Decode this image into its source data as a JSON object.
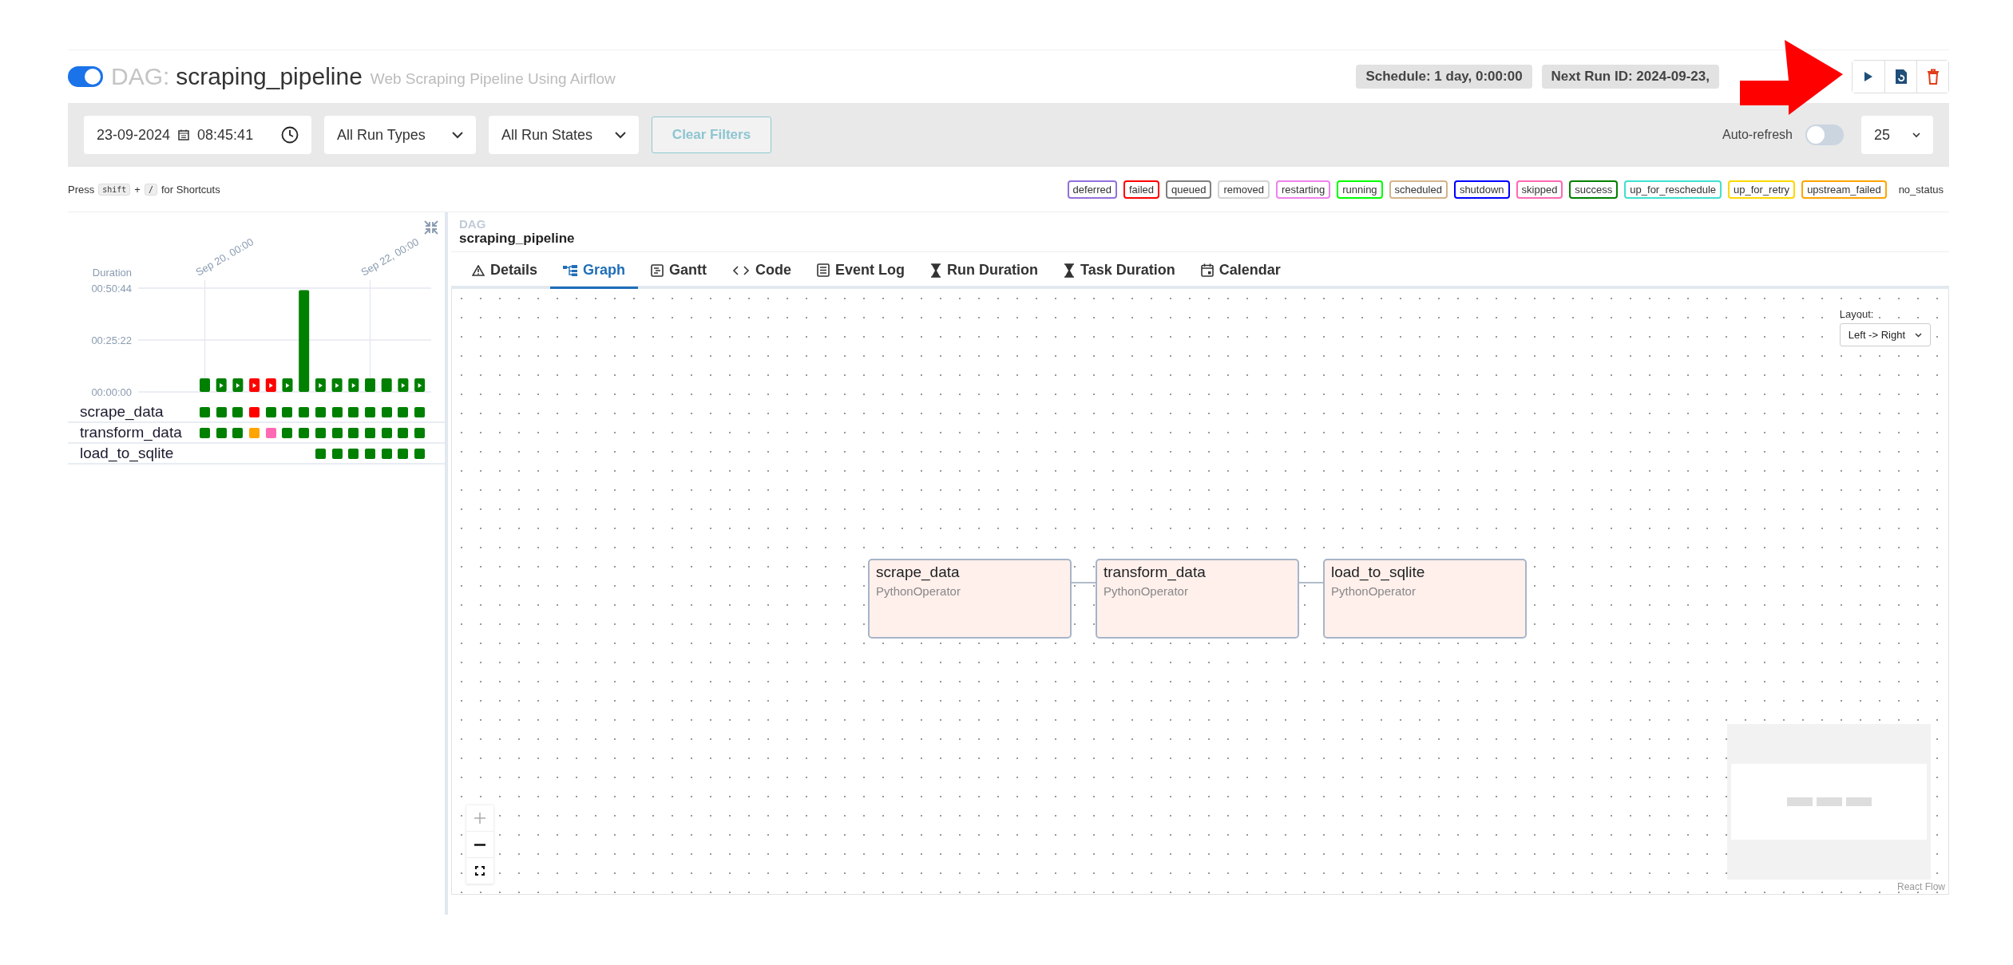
{
  "dag": {
    "active": true,
    "prefix": "DAG:",
    "name": "scraping_pipeline",
    "description": "Web Scraping Pipeline Using Airflow"
  },
  "header_badges": [
    "Schedule: 1 day, 0:00:00",
    "Next Run ID: 2024-09-23,"
  ],
  "filters": {
    "date": "23-09-2024",
    "time": "08:45:41",
    "run_type": "All Run Types",
    "run_state": "All Run States",
    "clear_button": {
      "label": "Clear Filters",
      "disabled": true
    },
    "auto_refresh": {
      "label": "Auto-refresh",
      "on": false
    },
    "page_size": "25"
  },
  "shortcuts": {
    "prefix": "Press",
    "keys": [
      "shift",
      "/"
    ],
    "joiner": "+",
    "suffix": "for Shortcuts"
  },
  "legend": [
    {
      "label": "deferred",
      "color": "#9370db"
    },
    {
      "label": "failed",
      "color": "#ff0000"
    },
    {
      "label": "queued",
      "color": "#808080"
    },
    {
      "label": "removed",
      "color": "#d3d3d3"
    },
    {
      "label": "restarting",
      "color": "#ee82ee"
    },
    {
      "label": "running",
      "color": "#00ff00"
    },
    {
      "label": "scheduled",
      "color": "#d2b48c"
    },
    {
      "label": "shutdown",
      "color": "#0000ff"
    },
    {
      "label": "skipped",
      "color": "#ff69b4"
    },
    {
      "label": "success",
      "color": "#008000"
    },
    {
      "label": "up_for_reschedule",
      "color": "#40e0d0"
    },
    {
      "label": "up_for_retry",
      "color": "#ffd700"
    },
    {
      "label": "upstream_failed",
      "color": "#ffa500"
    },
    {
      "label": "no_status"
    }
  ],
  "grid": {
    "duration_label": "Duration",
    "date_labels": [
      "Sep 20, 00:00",
      "Sep 22, 00:00"
    ],
    "y_labels": [
      "00:50:44",
      "00:25:22",
      "00:00:00"
    ],
    "runs": [
      {
        "color": "#008000",
        "manual": false,
        "level": 0.13
      },
      {
        "color": "#008000",
        "manual": true,
        "level": 0.13
      },
      {
        "color": "#008000",
        "manual": true,
        "level": 0.13
      },
      {
        "color": "#ff0000",
        "manual": true,
        "level": 0.13
      },
      {
        "color": "#ff0000",
        "manual": true,
        "level": 0.13
      },
      {
        "color": "#008000",
        "manual": true,
        "level": 0.13
      },
      {
        "color": "#008000",
        "manual": false,
        "level": 0.98
      },
      {
        "color": "#008000",
        "manual": true,
        "level": 0.13
      },
      {
        "color": "#008000",
        "manual": true,
        "level": 0.13
      },
      {
        "color": "#008000",
        "manual": true,
        "level": 0.13
      },
      {
        "color": "#008000",
        "manual": false,
        "level": 0.13
      },
      {
        "color": "#008000",
        "manual": false,
        "level": 0.13
      },
      {
        "color": "#008000",
        "manual": true,
        "level": 0.13
      },
      {
        "color": "#008000",
        "manual": true,
        "level": 0.13
      }
    ],
    "tasks": [
      {
        "name": "scrape_data",
        "cells": [
          {
            "kind": "status",
            "color": "#008000"
          },
          {
            "kind": "status",
            "color": "#008000"
          },
          {
            "kind": "status",
            "color": "#008000"
          },
          {
            "kind": "status",
            "color": "#ff0000"
          },
          {
            "kind": "status",
            "color": "#008000"
          },
          {
            "kind": "status",
            "color": "#008000"
          },
          {
            "kind": "status",
            "color": "#008000"
          },
          {
            "kind": "status",
            "color": "#008000"
          },
          {
            "kind": "status",
            "color": "#008000"
          },
          {
            "kind": "status",
            "color": "#008000"
          },
          {
            "kind": "status",
            "color": "#008000"
          },
          {
            "kind": "status",
            "color": "#008000"
          },
          {
            "kind": "status",
            "color": "#008000"
          },
          {
            "kind": "status",
            "color": "#008000"
          }
        ]
      },
      {
        "name": "transform_data",
        "cells": [
          {
            "kind": "status",
            "color": "#008000"
          },
          {
            "kind": "status",
            "color": "#008000"
          },
          {
            "kind": "status",
            "color": "#008000"
          },
          {
            "kind": "status",
            "color": "#ffa500"
          },
          {
            "kind": "status",
            "color": "#ff69b4"
          },
          {
            "kind": "status",
            "color": "#008000"
          },
          {
            "kind": "status",
            "color": "#008000"
          },
          {
            "kind": "status",
            "color": "#008000"
          },
          {
            "kind": "status",
            "color": "#008000"
          },
          {
            "kind": "status",
            "color": "#008000"
          },
          {
            "kind": "status",
            "color": "#008000"
          },
          {
            "kind": "status",
            "color": "#008000"
          },
          {
            "kind": "status",
            "color": "#008000"
          },
          {
            "kind": "status",
            "color": "#008000"
          }
        ]
      },
      {
        "name": "load_to_sqlite",
        "cells": [
          {
            "kind": "empty"
          },
          {
            "kind": "empty"
          },
          {
            "kind": "empty"
          },
          {
            "kind": "empty"
          },
          {
            "kind": "empty"
          },
          {
            "kind": "empty"
          },
          {
            "kind": "empty"
          },
          {
            "kind": "status",
            "color": "#008000"
          },
          {
            "kind": "status",
            "color": "#008000"
          },
          {
            "kind": "status",
            "color": "#008000"
          },
          {
            "kind": "status",
            "color": "#008000"
          },
          {
            "kind": "status",
            "color": "#008000"
          },
          {
            "kind": "status",
            "color": "#008000"
          },
          {
            "kind": "status",
            "color": "#008000"
          }
        ]
      }
    ]
  },
  "details": {
    "label": "DAG",
    "name": "scraping_pipeline"
  },
  "tabs": [
    {
      "label": "Details",
      "selected": false
    },
    {
      "label": "Graph",
      "selected": true
    },
    {
      "label": "Gantt",
      "selected": false
    },
    {
      "label": "Code",
      "selected": false
    },
    {
      "label": "Event Log",
      "selected": false
    },
    {
      "label": "Run Duration",
      "selected": false
    },
    {
      "label": "Task Duration",
      "selected": false
    },
    {
      "label": "Calendar",
      "selected": false
    }
  ],
  "graph": {
    "layout_label": "Layout:",
    "layout_value": "Left -> Right",
    "nodes": [
      {
        "name": "scrape_data",
        "operator": "PythonOperator"
      },
      {
        "name": "transform_data",
        "operator": "PythonOperator"
      },
      {
        "name": "load_to_sqlite",
        "operator": "PythonOperator"
      }
    ],
    "attribution": "React Flow"
  }
}
